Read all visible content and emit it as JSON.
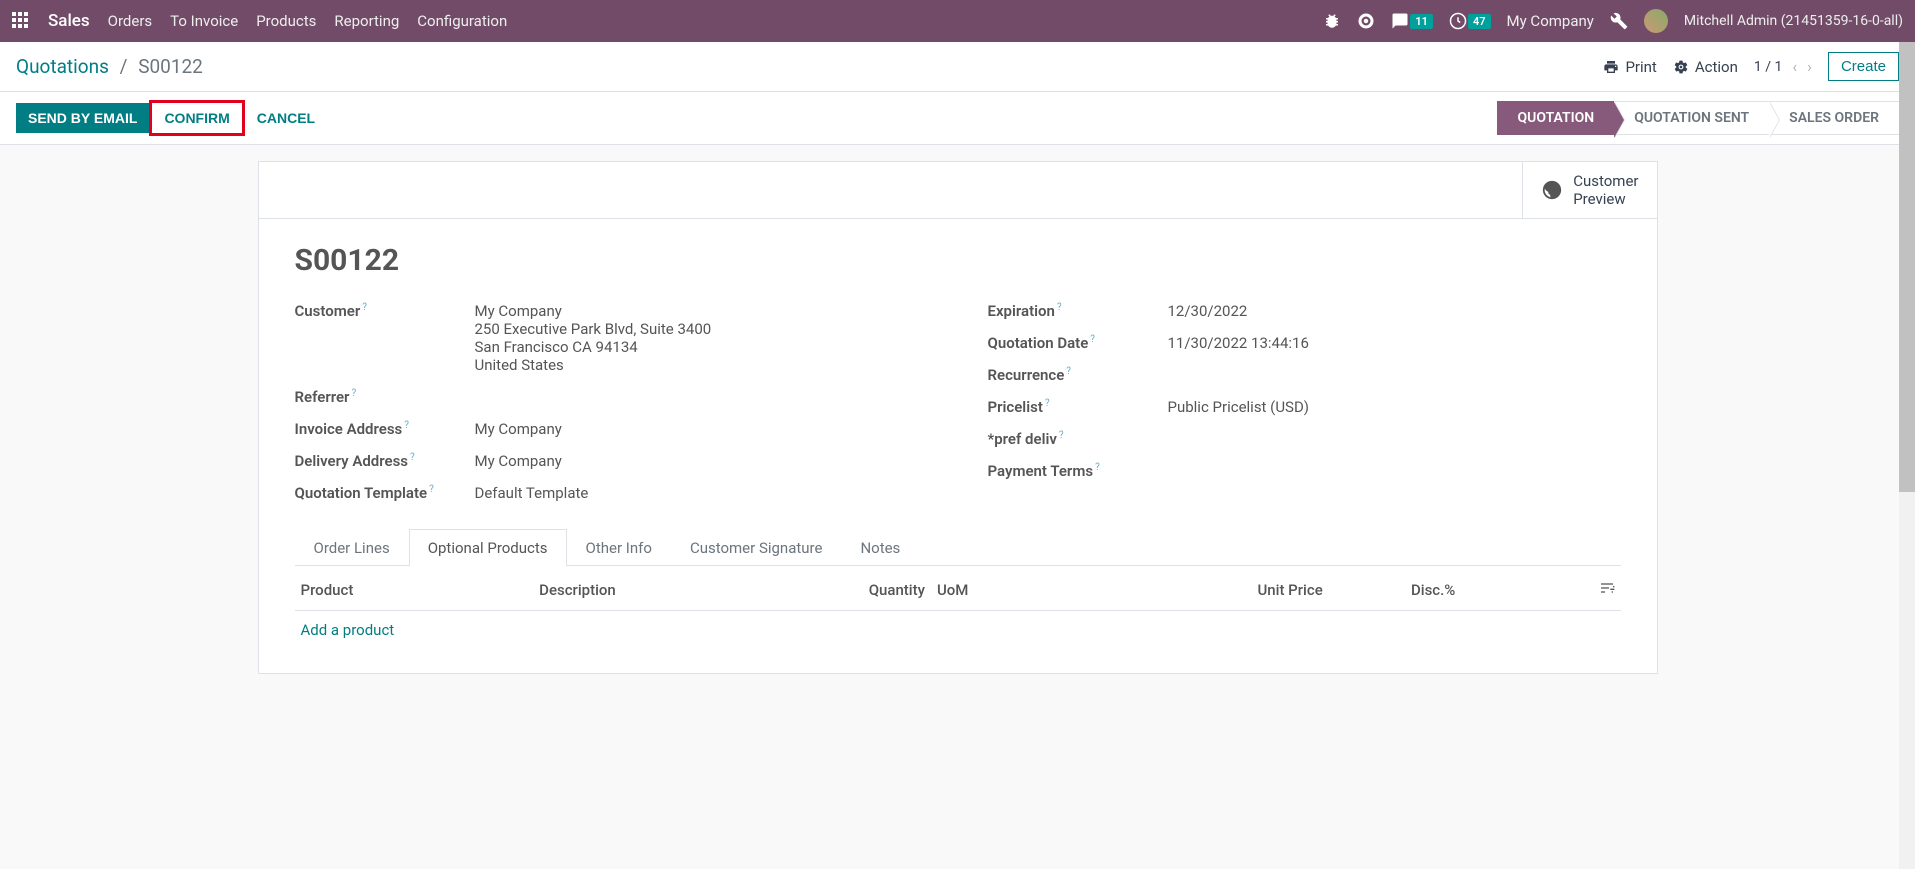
{
  "topnav": {
    "brand": "Sales",
    "items": [
      "Orders",
      "To Invoice",
      "Products",
      "Reporting",
      "Configuration"
    ],
    "messages_badge": "11",
    "activities_badge": "47",
    "company": "My Company",
    "user": "Mitchell Admin (21451359-16-0-all)"
  },
  "breadcrumb": {
    "root": "Quotations",
    "current": "S00122"
  },
  "cp": {
    "print": "Print",
    "action": "Action",
    "pager": "1 / 1",
    "create": "Create"
  },
  "buttons": {
    "send": "SEND BY EMAIL",
    "confirm": "CONFIRM",
    "cancel": "CANCEL"
  },
  "stages": [
    "QUOTATION",
    "QUOTATION SENT",
    "SALES ORDER"
  ],
  "button_box": {
    "preview": "Customer\nPreview"
  },
  "record": {
    "name": "S00122",
    "left": {
      "customer_label": "Customer",
      "customer_name": "My Company",
      "customer_addr1": "250 Executive Park Blvd, Suite 3400",
      "customer_addr2": "San Francisco CA 94134",
      "customer_addr3": "United States",
      "referrer_label": "Referrer",
      "invoice_addr_label": "Invoice Address",
      "invoice_addr": "My Company",
      "delivery_addr_label": "Delivery Address",
      "delivery_addr": "My Company",
      "template_label": "Quotation Template",
      "template": "Default Template"
    },
    "right": {
      "expiration_label": "Expiration",
      "expiration": "12/30/2022",
      "qdate_label": "Quotation Date",
      "qdate": "11/30/2022 13:44:16",
      "recurrence_label": "Recurrence",
      "pricelist_label": "Pricelist",
      "pricelist": "Public Pricelist (USD)",
      "pref_label": "*pref deliv",
      "payment_label": "Payment Terms"
    }
  },
  "tabs": [
    "Order Lines",
    "Optional Products",
    "Other Info",
    "Customer Signature",
    "Notes"
  ],
  "table": {
    "cols": {
      "product": "Product",
      "desc": "Description",
      "qty": "Quantity",
      "uom": "UoM",
      "price": "Unit Price",
      "disc": "Disc.%"
    },
    "add": "Add a product"
  }
}
